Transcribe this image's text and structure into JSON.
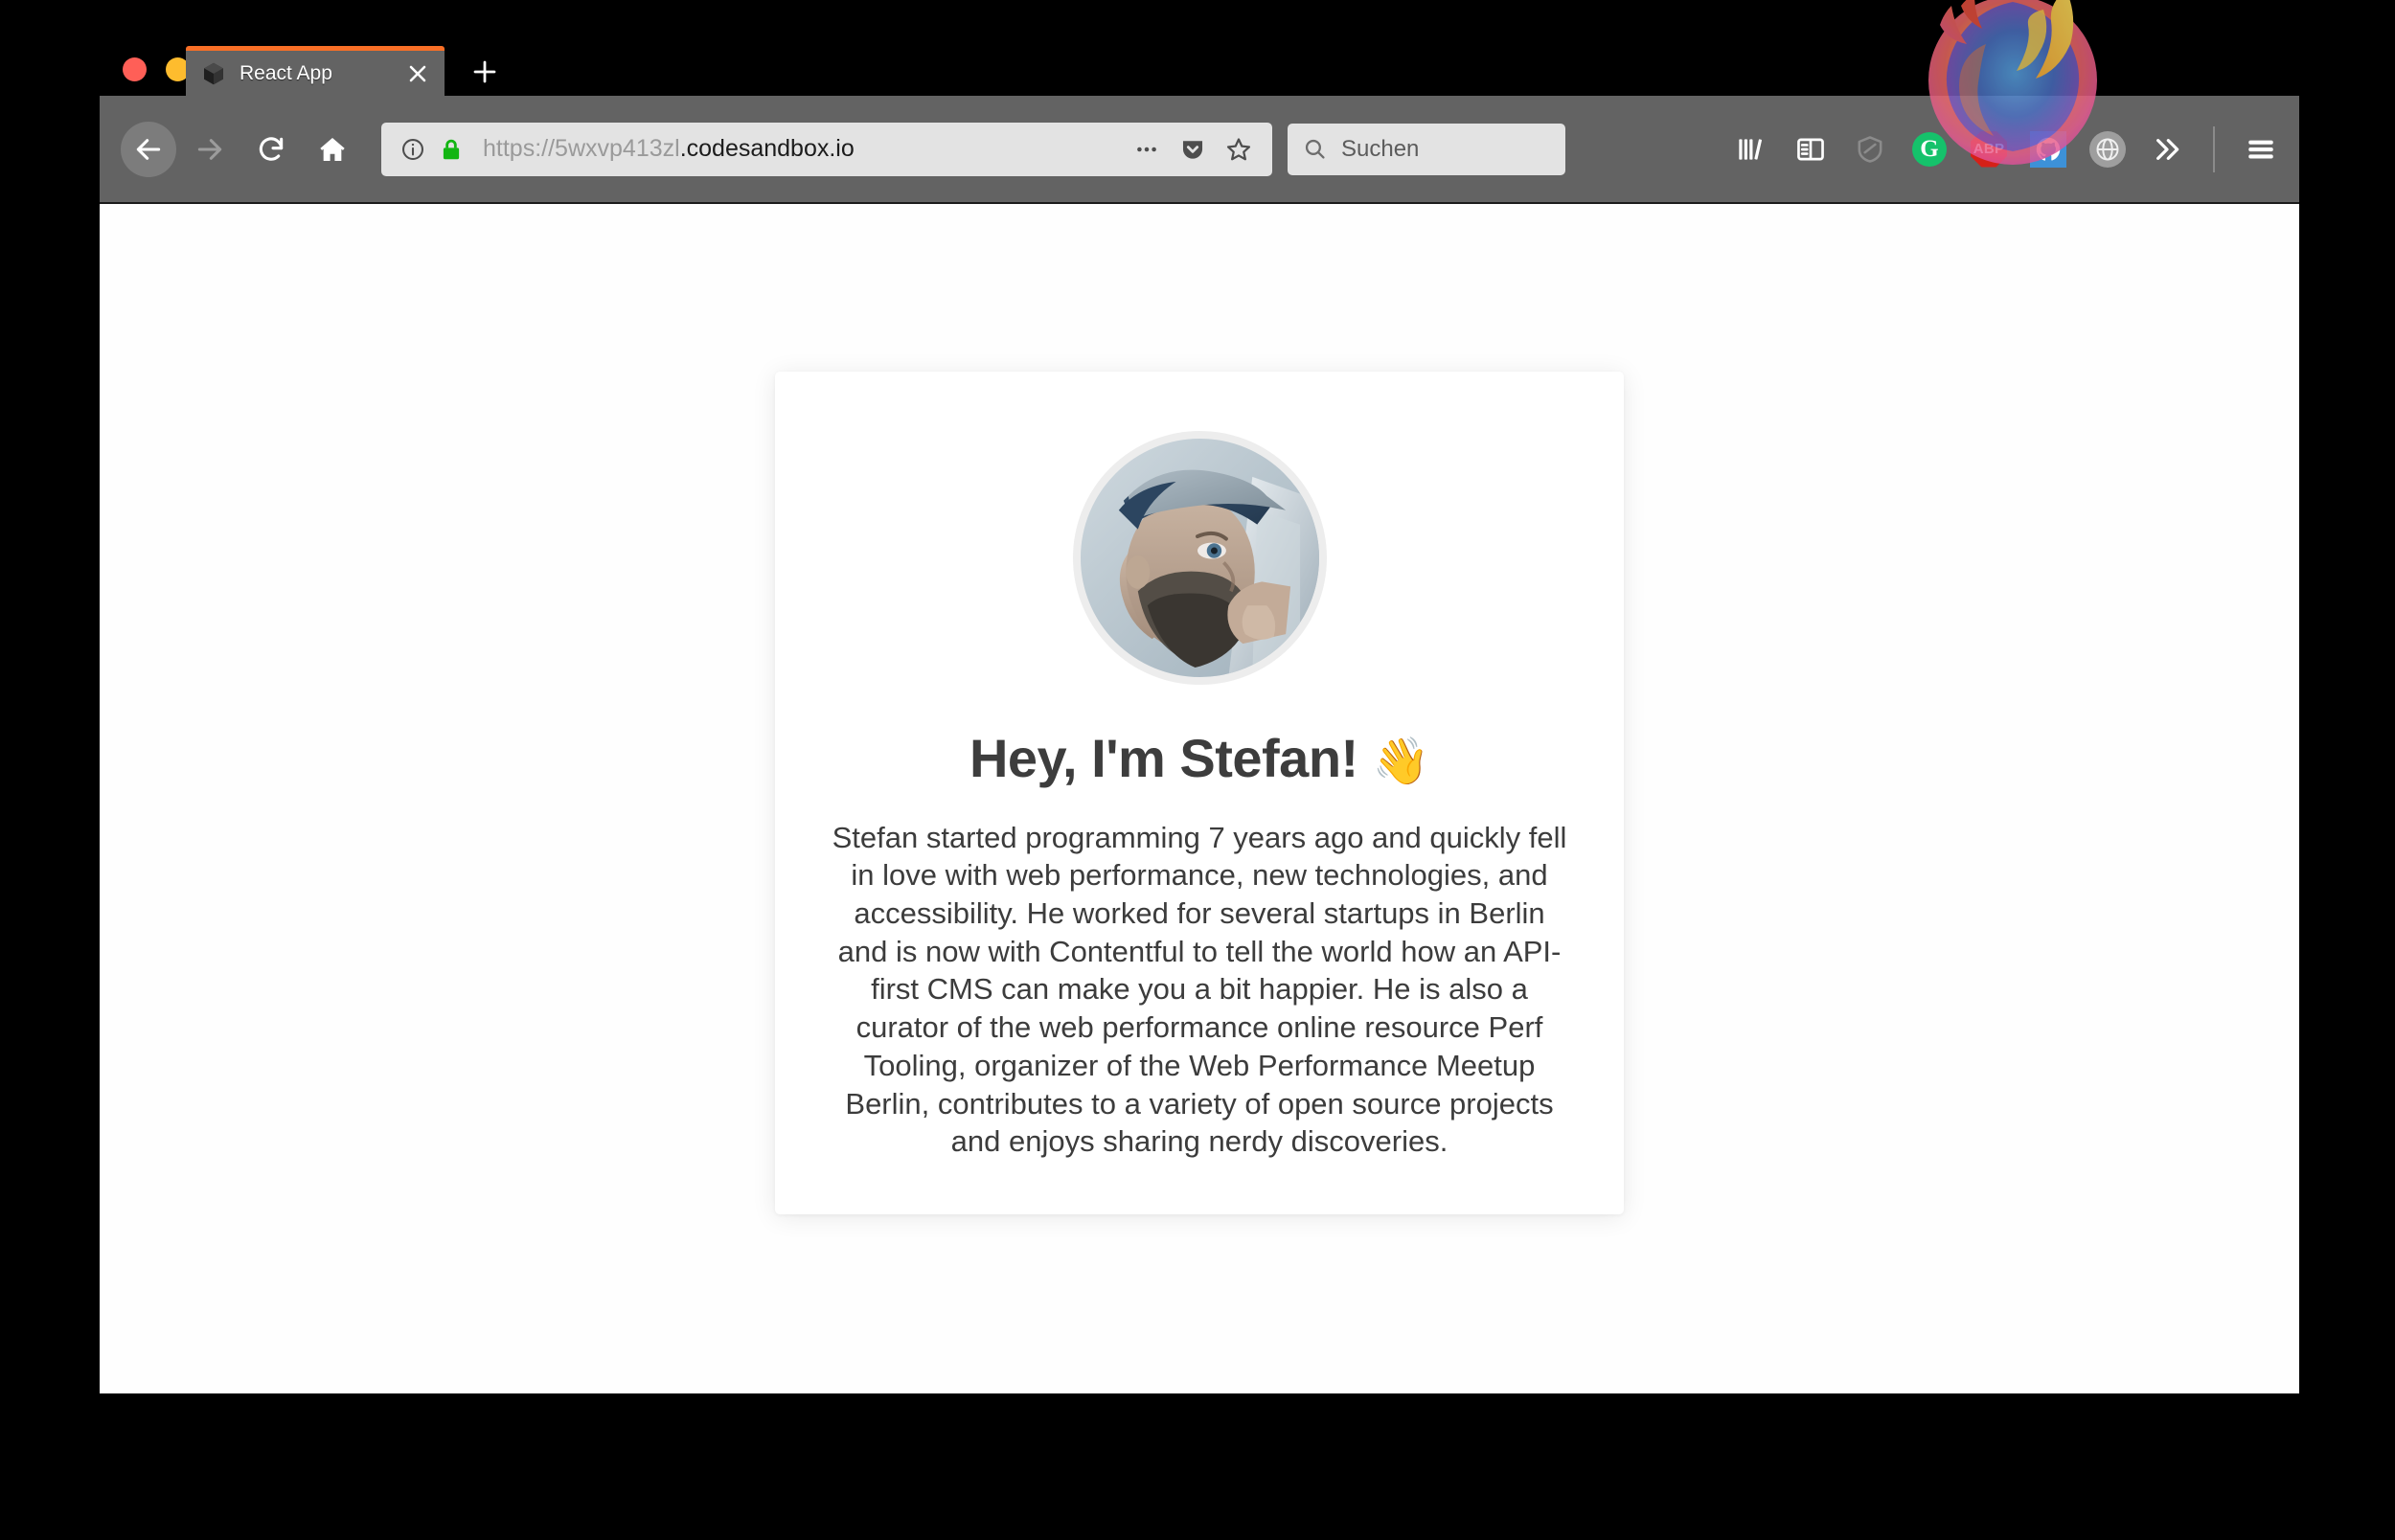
{
  "window": {
    "traffic_lights": [
      {
        "name": "close",
        "color": "#ff5f57"
      },
      {
        "name": "minimize",
        "color": "#febc2e"
      },
      {
        "name": "zoom",
        "color": "#28c840"
      }
    ]
  },
  "tabs": [
    {
      "title": "React App",
      "favicon": "codesandbox-cube-icon",
      "active": true,
      "accent_color": "#f96f26",
      "close_label": "✕"
    }
  ],
  "new_tab": {
    "label": "+"
  },
  "navigation": {
    "back": "back-arrow-icon",
    "forward": "forward-arrow-icon",
    "reload": "reload-icon",
    "home": "home-icon"
  },
  "urlbar": {
    "identity_icon": "info-circle-icon",
    "lock_icon": "padlock-icon",
    "lock_color": "#12b512",
    "scheme": "https://",
    "subdomain": "5wxvp413zl",
    "domain": ".codesandbox.io",
    "full_url": "https://5wxvp413zl.codesandbox.io",
    "actions": [
      {
        "name": "page-actions-icon",
        "label": "•••"
      },
      {
        "name": "pocket-icon",
        "label": ""
      },
      {
        "name": "bookmark-star-icon",
        "label": ""
      }
    ]
  },
  "search": {
    "icon": "search-icon",
    "placeholder": "Suchen",
    "value": ""
  },
  "toolbar_icons": [
    {
      "name": "library-icon",
      "type": "glyph"
    },
    {
      "name": "sidebar-icon",
      "type": "glyph"
    },
    {
      "name": "shield-icon",
      "type": "glyph",
      "dim": true
    },
    {
      "name": "grammarly-extension-icon",
      "type": "badge",
      "label": "G",
      "color": "#15c26b"
    },
    {
      "name": "adblock-plus-extension-icon",
      "type": "badge",
      "label": "ABP",
      "color": "#d62018"
    },
    {
      "name": "github-extension-icon",
      "type": "badge",
      "label": "",
      "color": "#3d91d8"
    },
    {
      "name": "globe-extension-icon",
      "type": "badge",
      "label": "",
      "color": "#9e9e9e"
    },
    {
      "name": "overflow-chevrons-icon",
      "type": "glyph"
    },
    {
      "name": "app-menu-icon",
      "type": "glyph"
    }
  ],
  "firefox_logo": {
    "name": "firefox-logo",
    "visible": true
  },
  "page": {
    "background": "#fefefe",
    "card": {
      "avatar_alt": "Portrait of Stefan wearing a backwards cap",
      "title": "Hey, I'm Stefan! ",
      "title_emoji": "👋",
      "body": "Stefan started programming 7 years ago and quickly fell in love with web performance, new technologies, and accessibility. He worked for several startups in Berlin and is now with Contentful to tell the world how an API-first CMS can make you a bit happier. He is also a curator of the web performance online resource Perf Tooling, organizer of the Web Performance Meetup Berlin, contributes to a variety of open source projects and enjoys sharing nerdy discoveries."
    }
  }
}
